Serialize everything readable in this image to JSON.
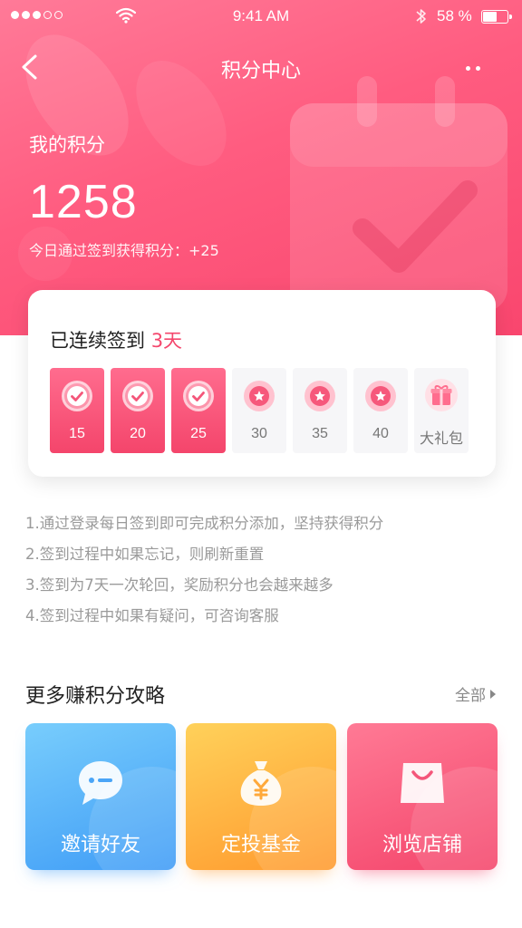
{
  "status_bar": {
    "time": "9:41 AM",
    "battery_percent": "58 %",
    "battery_level": 0.58,
    "signal_bars_filled": 3,
    "signal_bars_total": 5
  },
  "nav": {
    "title": "积分中心"
  },
  "points": {
    "label": "我的积分",
    "value": "1258",
    "today_text": "今日通过签到获得积分：+25"
  },
  "signin": {
    "streak_prefix": "已连续签到",
    "streak_days": "3天",
    "days": [
      {
        "value": "15",
        "done": true
      },
      {
        "value": "20",
        "done": true
      },
      {
        "value": "25",
        "done": true
      },
      {
        "value": "30",
        "done": false
      },
      {
        "value": "35",
        "done": false
      },
      {
        "value": "40",
        "done": false
      },
      {
        "value": "大礼包",
        "done": false,
        "gift": true
      }
    ]
  },
  "rules": [
    "1.通过登录每日签到即可完成积分添加，坚持获得积分",
    "2.签到过程中如果忘记，则刷新重置",
    "3.签到为7天一次轮回，奖励积分也会越来越多",
    "4.签到过程中如果有疑问，可咨询客服"
  ],
  "more": {
    "title": "更多赚积分攻略",
    "see_all": "全部"
  },
  "tiles": [
    {
      "label": "邀请好友",
      "icon": "chat-bubble-icon"
    },
    {
      "label": "定投基金",
      "icon": "money-bag-icon"
    },
    {
      "label": "浏览店铺",
      "icon": "shopping-bag-icon"
    }
  ],
  "colors": {
    "accent": "#f4476d",
    "invite_tile": "#3f9cf6",
    "fund_tile": "#ff9a2e",
    "shop_tile": "#f4456b"
  }
}
